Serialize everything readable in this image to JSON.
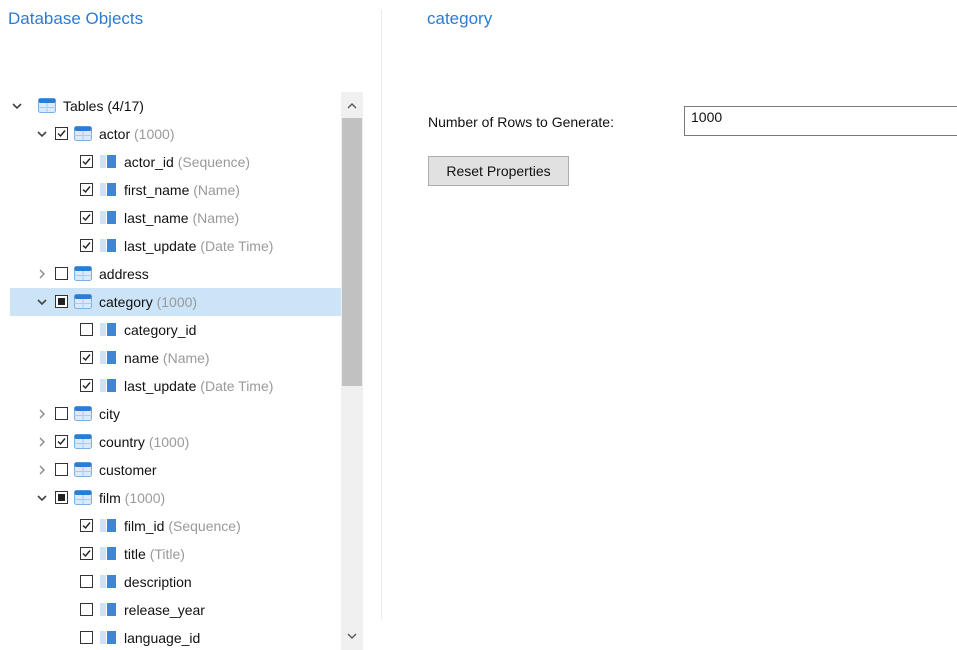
{
  "panels": {
    "left_title": "Database Objects",
    "right_title": "category"
  },
  "properties": {
    "rows_label": "Number of Rows to Generate:",
    "rows_value": "1000",
    "reset_label": "Reset Properties"
  },
  "tree": [
    {
      "level": 0,
      "expander": "expanded",
      "check": "none",
      "icon": "table-icon",
      "label": "Tables (4/17)",
      "detail": ""
    },
    {
      "level": 1,
      "expander": "expanded",
      "check": "checked",
      "icon": "table-icon",
      "label": "actor",
      "detail": "(1000)"
    },
    {
      "level": 2,
      "expander": "none",
      "check": "checked",
      "icon": "column-icon",
      "label": "actor_id",
      "detail": "(Sequence)"
    },
    {
      "level": 2,
      "expander": "none",
      "check": "checked",
      "icon": "column-icon",
      "label": "first_name",
      "detail": "(Name)"
    },
    {
      "level": 2,
      "expander": "none",
      "check": "checked",
      "icon": "column-icon",
      "label": "last_name",
      "detail": "(Name)"
    },
    {
      "level": 2,
      "expander": "none",
      "check": "checked",
      "icon": "column-icon",
      "label": "last_update",
      "detail": "(Date Time)"
    },
    {
      "level": 1,
      "expander": "collapsed",
      "check": "unchecked",
      "icon": "table-icon",
      "label": "address",
      "detail": ""
    },
    {
      "level": 1,
      "expander": "expanded",
      "check": "indeterminate",
      "icon": "table-icon",
      "label": "category",
      "detail": "(1000)",
      "selected": true
    },
    {
      "level": 2,
      "expander": "none",
      "check": "unchecked",
      "icon": "column-icon",
      "label": "category_id",
      "detail": ""
    },
    {
      "level": 2,
      "expander": "none",
      "check": "checked",
      "icon": "column-icon",
      "label": "name",
      "detail": "(Name)"
    },
    {
      "level": 2,
      "expander": "none",
      "check": "checked",
      "icon": "column-icon",
      "label": "last_update",
      "detail": "(Date Time)"
    },
    {
      "level": 1,
      "expander": "collapsed",
      "check": "unchecked",
      "icon": "table-icon",
      "label": "city",
      "detail": ""
    },
    {
      "level": 1,
      "expander": "collapsed",
      "check": "checked",
      "icon": "table-icon",
      "label": "country",
      "detail": "(1000)"
    },
    {
      "level": 1,
      "expander": "collapsed",
      "check": "unchecked",
      "icon": "table-icon",
      "label": "customer",
      "detail": ""
    },
    {
      "level": 1,
      "expander": "expanded",
      "check": "indeterminate",
      "icon": "table-icon",
      "label": "film",
      "detail": "(1000)"
    },
    {
      "level": 2,
      "expander": "none",
      "check": "checked",
      "icon": "column-icon",
      "label": "film_id",
      "detail": "(Sequence)"
    },
    {
      "level": 2,
      "expander": "none",
      "check": "checked",
      "icon": "column-icon",
      "label": "title",
      "detail": "(Title)"
    },
    {
      "level": 2,
      "expander": "none",
      "check": "unchecked",
      "icon": "column-icon",
      "label": "description",
      "detail": ""
    },
    {
      "level": 2,
      "expander": "none",
      "check": "unchecked",
      "icon": "column-icon",
      "label": "release_year",
      "detail": ""
    },
    {
      "level": 2,
      "expander": "none",
      "check": "unchecked",
      "icon": "column-icon",
      "label": "language_id",
      "detail": ""
    }
  ],
  "colors": {
    "title_blue": "#2b7cd3",
    "selection": "#cce4f7",
    "detail_gray": "#9a9a9a"
  }
}
